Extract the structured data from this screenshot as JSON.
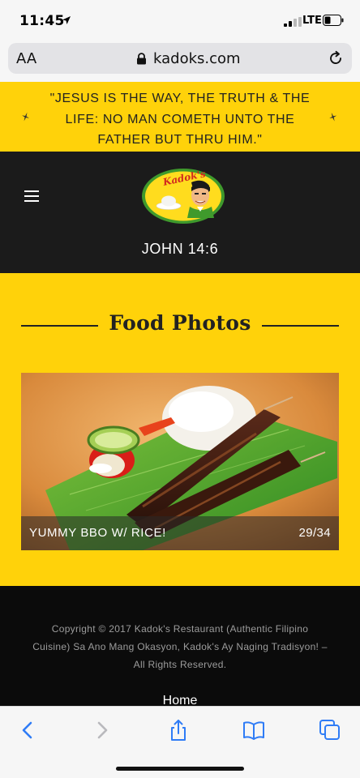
{
  "status_bar": {
    "time": "11:45",
    "network": "LTE",
    "icons": [
      "location-arrow-icon",
      "signal-bars-icon",
      "battery-icon"
    ]
  },
  "browser": {
    "text_size_label": "AA",
    "url": "kadoks.com",
    "icons": [
      "lock-icon",
      "reload-icon"
    ]
  },
  "quote": {
    "text": "\"JESUS IS THE WAY, THE TRUTH & THE LIFE: NO MAN COMETH UNTO THE FATHER BUT THRU HIM.\""
  },
  "header": {
    "logo_text": "Kadok's",
    "verse": "JOHN 14:6",
    "menu_icon": "hamburger-menu-icon"
  },
  "main": {
    "section_title": "Food Photos",
    "photo": {
      "caption": "YUMMY BBO W/ RICE!",
      "counter": "29/34"
    }
  },
  "footer": {
    "copyright": "Copyright © 2017 Kadok's Restaurant (Authentic Filipino Cuisine) Sa Ano Mang Okasyon, Kadok's Ay Naging Tradisyon! – All Rights Reserved.",
    "home_link": "Home"
  },
  "toolbar": {
    "buttons": [
      "back-icon",
      "forward-icon",
      "share-icon",
      "bookmarks-icon",
      "tabs-icon"
    ]
  },
  "colors": {
    "brand_yellow": "#ffd20a",
    "header_dark": "#1b1b1b",
    "footer_black": "#0b0b0b",
    "ios_blue": "#2f7cf6"
  }
}
